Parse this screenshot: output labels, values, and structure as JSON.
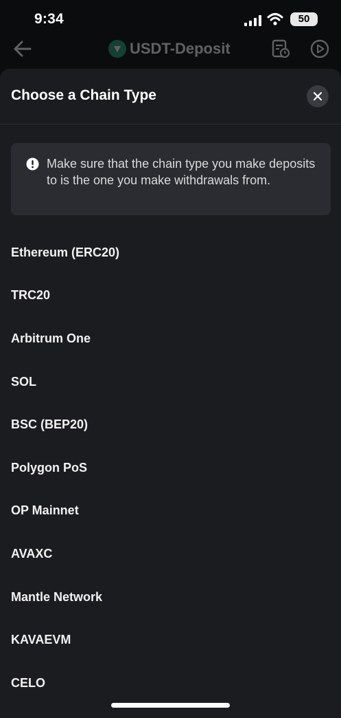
{
  "status_bar": {
    "time": "9:34",
    "battery": "50"
  },
  "header": {
    "title": "USDT-Deposit"
  },
  "sheet": {
    "title": "Choose a Chain Type",
    "notice": "Make sure that the chain type you make deposits to is the one you make withdrawals from.",
    "chains": [
      "Ethereum (ERC20)",
      "TRC20",
      "Arbitrum One",
      "SOL",
      "BSC (BEP20)",
      "Polygon PoS",
      "OP Mainnet",
      "AVAXC",
      "Mantle Network",
      "KAVAEVM",
      "CELO"
    ]
  },
  "colors": {
    "background": "#0b0c0e",
    "sheet": "#1b1c20",
    "notice_box": "#2b2c31",
    "usdt_brand": "#26a17b"
  },
  "icons": {
    "back": "back-arrow-icon",
    "coin": "usdt-icon",
    "history": "history-icon",
    "play": "play-icon",
    "close": "close-icon",
    "notice": "info-icon"
  }
}
